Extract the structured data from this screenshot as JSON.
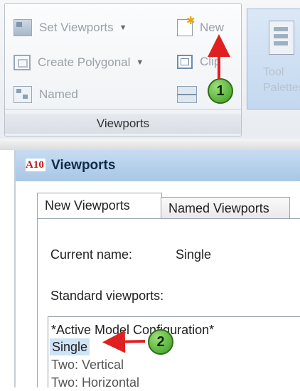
{
  "ribbon": {
    "set_viewports": "Set Viewports",
    "create_polygonal": "Create Polygonal",
    "named": "Named",
    "new": "New",
    "clip": "Clip",
    "panel_title": "Viewports",
    "tool_palettes": [
      "Tool",
      "Palettes"
    ]
  },
  "callouts": {
    "one": "1",
    "two": "2"
  },
  "dialog": {
    "app_icon": "A10",
    "title": "Viewports",
    "tabs": [
      "New Viewports",
      "Named Viewports"
    ],
    "current_name_label": "Current name:",
    "current_name_value": "Single",
    "standard_label": "Standard viewports:",
    "list": [
      "*Active Model Configuration*",
      "Single",
      "Two:  Vertical",
      "Two:  Horizontal"
    ]
  },
  "colors": {
    "callout_arrow": "#e02020",
    "callout_badge": "#4caf2a",
    "selected_row": "#cfe3f6"
  }
}
